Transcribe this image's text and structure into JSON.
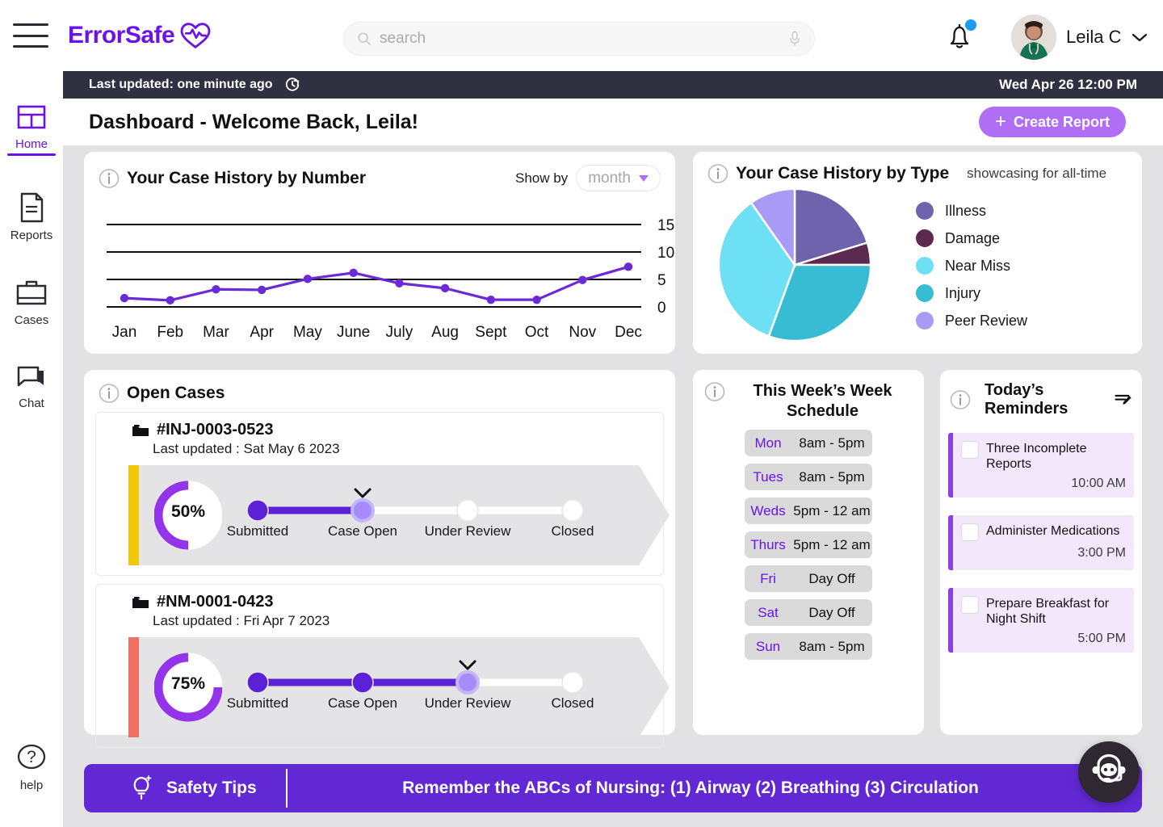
{
  "brand": {
    "name": "ErrorSafe",
    "logo_icon": "heart-pulse-icon",
    "color": "#6a12e8"
  },
  "search": {
    "placeholder": "search",
    "value": "",
    "icon": "search-icon",
    "mic_icon": "microphone-icon"
  },
  "user": {
    "name": "Leila C",
    "avatar_icon": "user-avatar",
    "chevron_icon": "chevron-down-icon",
    "notification_icon": "bell-icon",
    "notification_dot": true
  },
  "status_strip": {
    "last_updated": "Last updated: one minute ago",
    "refresh_icon": "refresh-clock-icon",
    "datetime": "Wed Apr 26 12:00 PM"
  },
  "page": {
    "title": "Dashboard - Welcome Back, Leila!",
    "create_button": "Create Report",
    "create_icon": "plus-icon"
  },
  "sidebar": {
    "menu_icon": "hamburger-menu-icon",
    "items": [
      {
        "label": "Home",
        "icon": "dashboard-grid-icon",
        "active": true
      },
      {
        "label": "Reports",
        "icon": "document-icon",
        "active": false
      },
      {
        "label": "Cases",
        "icon": "briefcase-icon",
        "active": false
      },
      {
        "label": "Chat",
        "icon": "chat-bubble-icon",
        "active": false
      }
    ],
    "help": {
      "label": "help",
      "icon": "question-circle-icon"
    }
  },
  "line_card": {
    "title": "Your Case History by Number",
    "info_icon": "info-icon",
    "show_by_label": "Show by",
    "show_by_value": "month",
    "caret_icon": "chevron-down-icon"
  },
  "pie_card": {
    "title": "Your Case History by Type",
    "info_icon": "info-icon",
    "subtitle": "showcasing for all-time"
  },
  "chart_data": [
    {
      "type": "line",
      "title": "Your Case History by Number",
      "xlabel": "",
      "ylabel": "",
      "categories": [
        "Jan",
        "Feb",
        "Mar",
        "Apr",
        "May",
        "June",
        "July",
        "Aug",
        "Sept",
        "Oct",
        "Nov",
        "Dec"
      ],
      "values": [
        1.6,
        1.2,
        3.2,
        3.1,
        5.1,
        6.2,
        4.3,
        3.4,
        1.3,
        1.3,
        4.9,
        7.3
      ],
      "ylim": [
        0,
        15
      ],
      "yticks": [
        0,
        5,
        10,
        15
      ],
      "grid": true,
      "legend": "none",
      "line_color": "#6a2ad8",
      "marker_color": "#6a2ad8"
    },
    {
      "type": "pie",
      "title": "Your Case History by Type",
      "subtitle": "showcasing for all-time",
      "legend_position": "right",
      "labels": [
        "Illness",
        "Damage",
        "Near Miss",
        "Injury",
        "Peer Review"
      ],
      "values": [
        20.5,
        5.0,
        34.5,
        30.5,
        9.5
      ],
      "colors": [
        "#6f63ae",
        "#5c2950",
        "#6de0f5",
        "#38bcd4",
        "#a99bf5"
      ],
      "slice_order_clockwise_from_top": [
        "Illness",
        "Damage",
        "Injury",
        "Near Miss",
        "Peer Review"
      ],
      "slice_degrees": [
        73,
        17,
        110,
        125,
        35
      ]
    }
  ],
  "open_cases": {
    "title": "Open Cases",
    "info_icon": "info-icon",
    "steps": [
      "Submitted",
      "Case Open",
      "Under Review",
      "Closed"
    ],
    "cases": [
      {
        "id": "#INJ-0003-0523",
        "folder_icon": "folder-icon",
        "last_updated": "Last updated : Sat May 6 2023",
        "progress": "50%",
        "progress_value": 50,
        "current_step_index": 1,
        "priority_color": "#f0c808"
      },
      {
        "id": "#NM-0001-0423",
        "folder_icon": "folder-icon",
        "last_updated": "Last updated : Fri Apr 7 2023",
        "progress": "75%",
        "progress_value": 75,
        "current_step_index": 2,
        "priority_color": "#ef6f63"
      }
    ]
  },
  "schedule": {
    "title": "This Week’s Week Schedule",
    "info_icon": "info-icon",
    "rows": [
      {
        "day": "Mon",
        "time": "8am - 5pm"
      },
      {
        "day": "Tues",
        "time": "8am - 5pm"
      },
      {
        "day": "Weds",
        "time": "5pm - 12 am"
      },
      {
        "day": "Thurs",
        "time": "5pm - 12 am"
      },
      {
        "day": "Fri",
        "time": "Day Off"
      },
      {
        "day": "Sat",
        "time": "Day Off"
      },
      {
        "day": "Sun",
        "time": "8am - 5pm"
      }
    ]
  },
  "reminders": {
    "title": "Today’s Reminders",
    "info_icon": "info-icon",
    "edit_icon": "edit-list-icon",
    "items": [
      {
        "text": "Three Incomplete Reports",
        "time": "10:00 AM",
        "checked": false
      },
      {
        "text": "Administer Medications",
        "time": "3:00 PM",
        "checked": false
      },
      {
        "text": "Prepare Breakfast for Night Shift",
        "time": "5:00 PM",
        "checked": false
      }
    ]
  },
  "banner": {
    "label": "Safety Tips",
    "icon": "lightbulb-icon",
    "message": "Remember the ABCs of Nursing: (1) Airway (2) Breathing (3) Circulation"
  },
  "chatbot": {
    "icon": "robot-headset-icon"
  },
  "colors": {
    "brand_purple": "#6a12e8",
    "accent_purple": "#6128d4",
    "button_purple": "#b06ef5",
    "dark_strip": "#2f3040",
    "canvas_gray": "#e2e2e4"
  }
}
